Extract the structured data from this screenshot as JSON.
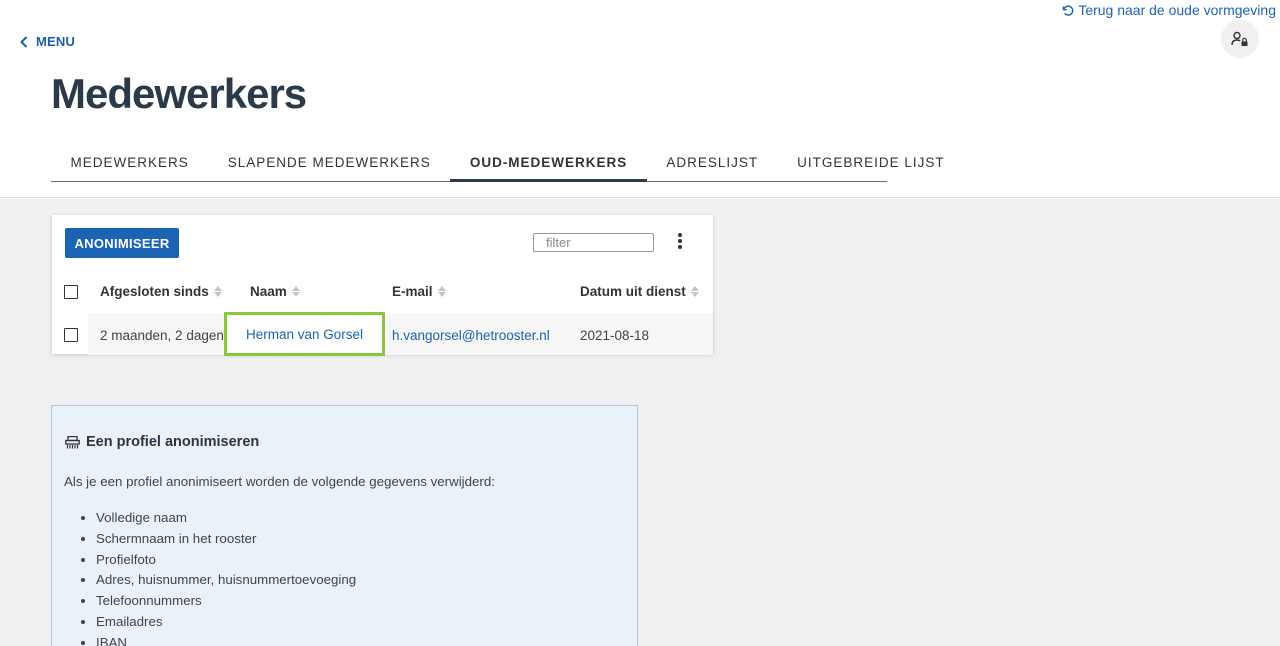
{
  "header": {
    "old_design_link": "Terug naar de oude vormgeving",
    "menu_label": "MENU",
    "page_title": "Medewerkers"
  },
  "tabs": [
    {
      "label": "MEDEWERKERS",
      "active": false
    },
    {
      "label": "SLAPENDE MEDEWERKERS",
      "active": false
    },
    {
      "label": "OUD-MEDEWERKERS",
      "active": true
    },
    {
      "label": "ADRESLIJST",
      "active": false
    },
    {
      "label": "UITGEBREIDE LIJST",
      "active": false
    }
  ],
  "table": {
    "anonymize_button": "ANONIMISEER",
    "filter_placeholder": "filter",
    "columns": [
      "Afgesloten sinds",
      "Naam",
      "E-mail",
      "Datum uit dienst"
    ],
    "rows": [
      {
        "closed_since": "2 maanden, 2 dagen",
        "name": "Herman van Gorsel",
        "email": "h.vangorsel@hetrooster.nl",
        "end_date": "2021-08-18"
      }
    ]
  },
  "info": {
    "title": "Een profiel anonimiseren",
    "description": "Als je een profiel anonimiseert worden de volgende gegevens verwijderd:",
    "items": [
      "Volledige naam",
      "Schermnaam in het rooster",
      "Profielfoto",
      "Adres, huisnummer, huisnummertoevoeging",
      "Telefoonnummers",
      "Emailadres",
      "IBAN"
    ]
  },
  "colors": {
    "primary": "#1b64b3",
    "highlight": "#8cc63f",
    "info_background": "#e9f1f9"
  }
}
